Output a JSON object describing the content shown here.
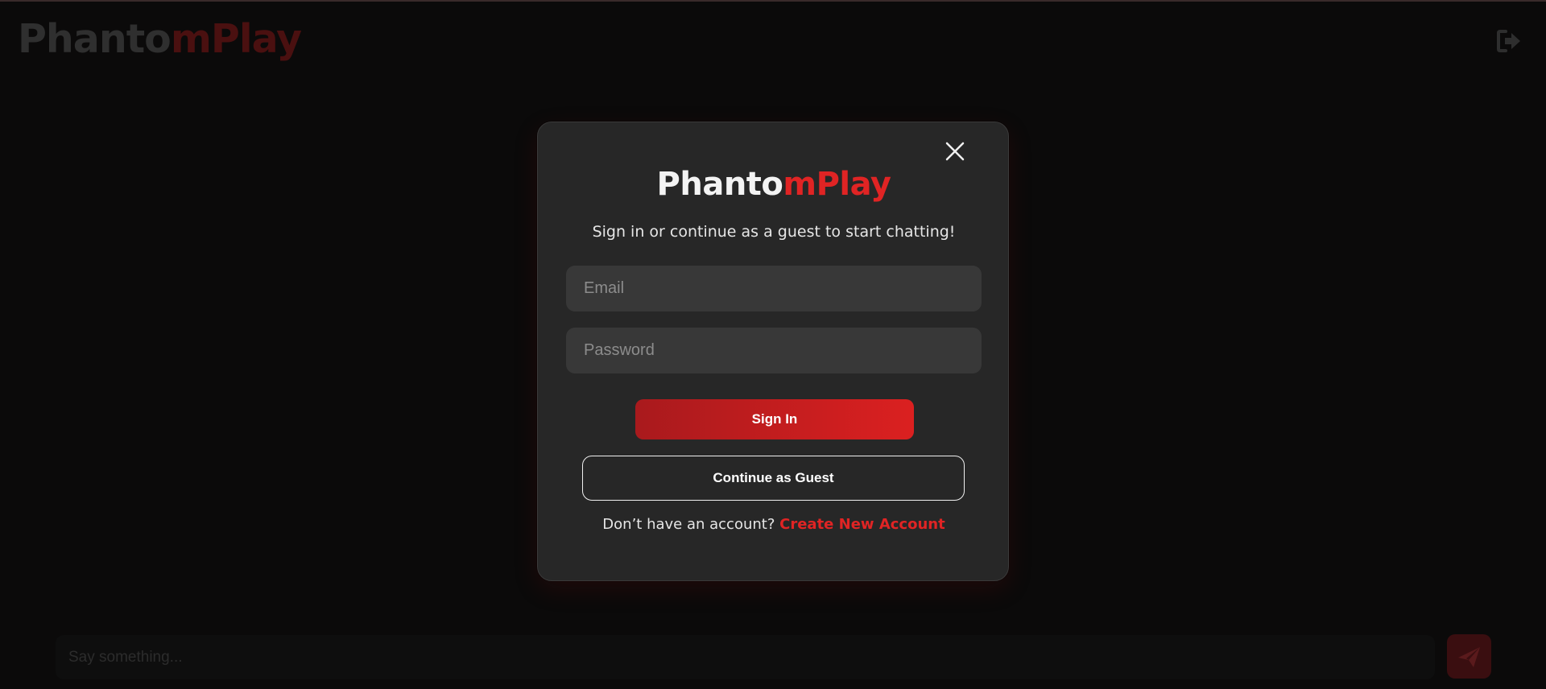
{
  "header": {
    "logo_part1": "Phanto",
    "logo_part2": "mPlay",
    "logout_icon": "logout-icon"
  },
  "modal": {
    "logo_part1": "Phanto",
    "logo_part2": "mPlay",
    "subtitle": "Sign in or continue as a guest to start chatting!",
    "close_icon": "close-icon",
    "email_placeholder": "Email",
    "password_placeholder": "Password",
    "signin_label": "Sign In",
    "guest_label": "Continue as Guest",
    "no_account_text": "Don’t have an account?",
    "create_account_label": "Create New Account"
  },
  "chat": {
    "input_placeholder": "Say something...",
    "send_icon": "paper-plane-icon"
  },
  "colors": {
    "background": "#0b0a0a",
    "modal_bg": "#272727",
    "accent": "#e02424",
    "field_bg": "#383838"
  }
}
